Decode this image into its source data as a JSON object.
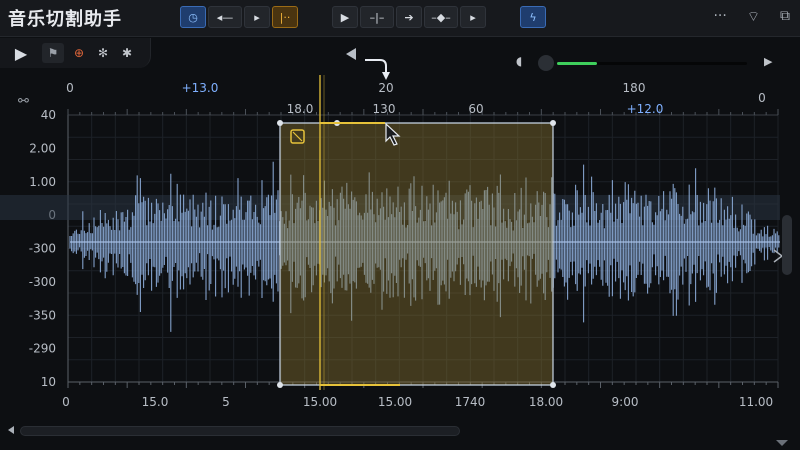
{
  "app": {
    "title": "音乐切割助手"
  },
  "toolbar": {
    "icons": [
      "clock-icon",
      "back-step-icon",
      "play-small-icon",
      "marker-icon",
      "play-icon",
      "trim-icon",
      "forward-icon",
      "split-icon",
      "next-icon",
      "lightning-icon",
      "more-icon",
      "wifi-icon",
      "window-icon"
    ]
  },
  "secondary_toolbar": {
    "icons": [
      "play-icon",
      "flag-icon",
      "target-icon",
      "snowflake-icon",
      "bug-icon"
    ]
  },
  "colors": {
    "accent_blue": "#4c86d8",
    "selection": "#caa84a",
    "waveform": "#8fb0de",
    "volume": "#3fcf5c"
  },
  "ruler_top": {
    "labels": [
      "0",
      "+13.0",
      "18.0",
      "20",
      "130",
      "60",
      "180",
      "+12.0",
      "0"
    ]
  },
  "chart_data": {
    "type": "area",
    "title": "",
    "y_tick_labels": [
      "40",
      "2.00",
      "1.00",
      "0",
      "-300",
      "-300",
      "-350",
      "-290",
      "10"
    ],
    "x_tick_labels": [
      "0",
      "15.0",
      "5",
      "15.00",
      "15.00",
      "1740",
      "18.00",
      "9:00",
      "11.00"
    ],
    "selection": {
      "start_label": "15.00",
      "end_label": "18.00"
    },
    "grid": true
  }
}
